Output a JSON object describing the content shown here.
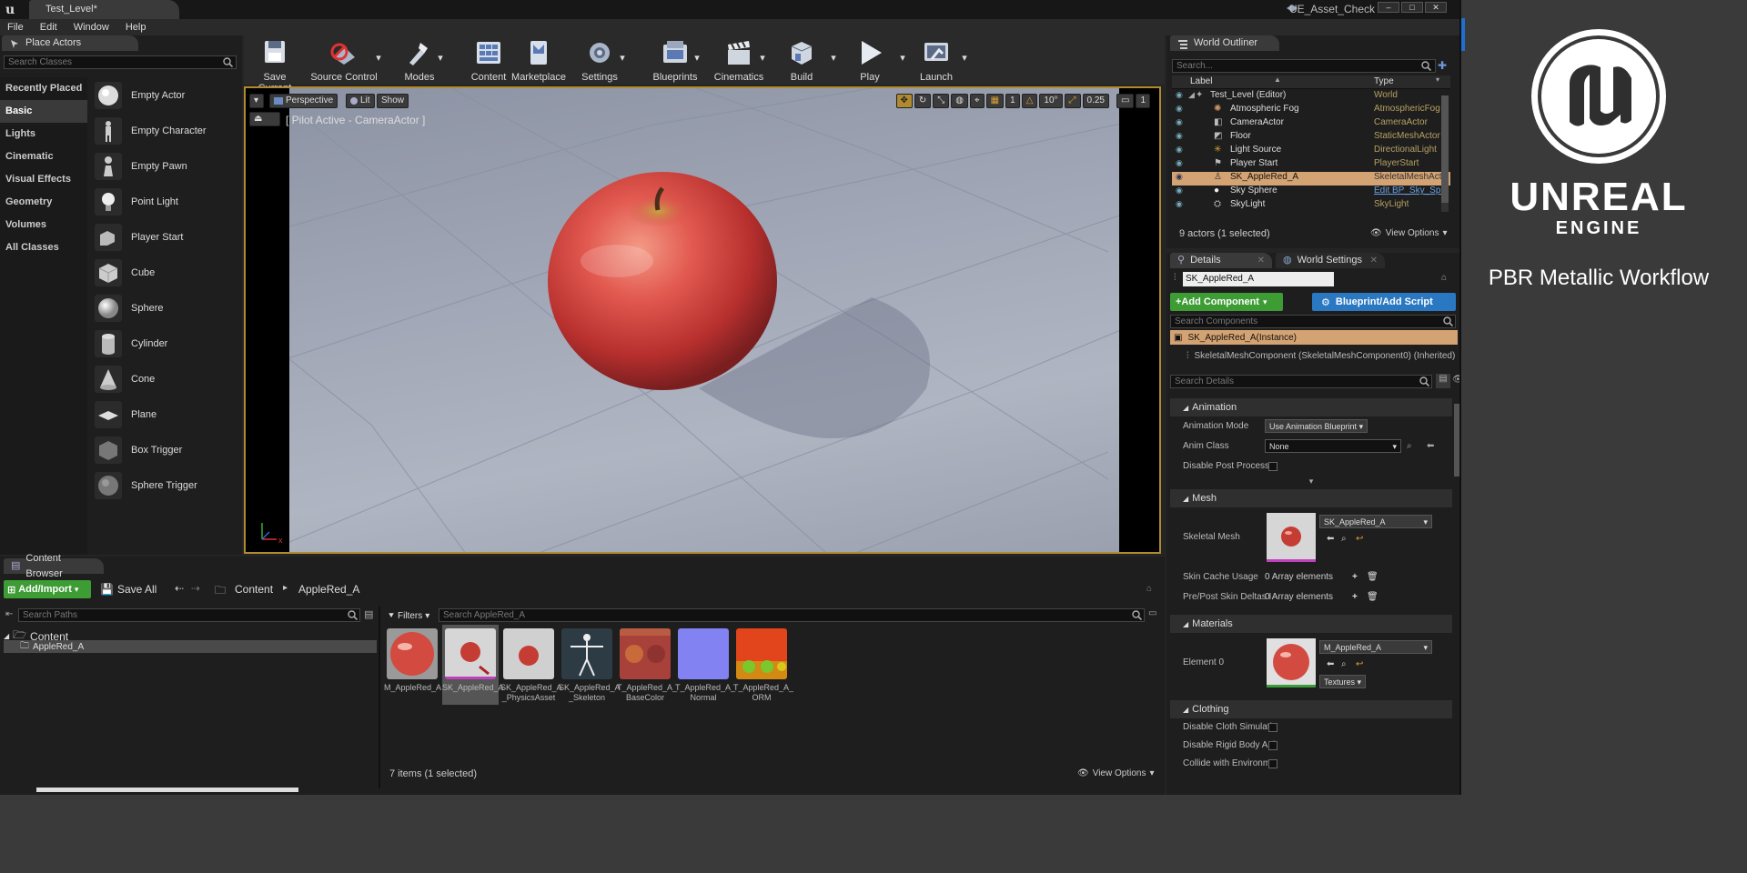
{
  "window": {
    "tab_title": "Test_Level*",
    "project_name": "UE_Asset_Check"
  },
  "menu": [
    "File",
    "Edit",
    "Window",
    "Help"
  ],
  "place_actors": {
    "tab": "Place Actors",
    "search_placeholder": "Search Classes",
    "categories": [
      "Recently Placed",
      "Basic",
      "Lights",
      "Cinematic",
      "Visual Effects",
      "Geometry",
      "Volumes",
      "All Classes"
    ],
    "selected_category": "Basic",
    "actors": [
      "Empty Actor",
      "Empty Character",
      "Empty Pawn",
      "Point Light",
      "Player Start",
      "Cube",
      "Sphere",
      "Cylinder",
      "Cone",
      "Plane",
      "Box Trigger",
      "Sphere Trigger"
    ]
  },
  "toolbar": {
    "save_current": "Save Current",
    "source_control": "Source Control",
    "modes": "Modes",
    "content": "Content",
    "marketplace": "Marketplace",
    "settings": "Settings",
    "blueprints": "Blueprints",
    "cinematics": "Cinematics",
    "build": "Build",
    "play": "Play",
    "launch": "Launch"
  },
  "viewport": {
    "perspective": "Perspective",
    "lit": "Lit",
    "show": "Show",
    "pilot_label": "[ Pilot Active - CameraActor ]",
    "grid_size": "1",
    "rotation_snap": "10°",
    "scale_snap": "0.25",
    "camera_speed": "1"
  },
  "outliner": {
    "tab": "World Outliner",
    "search_placeholder": "Search...",
    "col_label": "Label",
    "col_type": "Type",
    "rows": [
      {
        "label": "Test_Level (Editor)",
        "type": "World"
      },
      {
        "label": "Atmospheric Fog",
        "type": "AtmosphericFog"
      },
      {
        "label": "CameraActor",
        "type": "CameraActor"
      },
      {
        "label": "Floor",
        "type": "StaticMeshActor"
      },
      {
        "label": "Light Source",
        "type": "DirectionalLight"
      },
      {
        "label": "Player Start",
        "type": "PlayerStart"
      },
      {
        "label": "SK_AppleRed_A",
        "type": "SkeletalMeshActo"
      },
      {
        "label": "Sky Sphere",
        "type": "Edit BP_Sky_Sph"
      },
      {
        "label": "SkyLight",
        "type": "SkyLight"
      }
    ],
    "selected_index": 6,
    "status": "9 actors (1 selected)",
    "view_options": "View Options"
  },
  "details": {
    "tab_details": "Details",
    "tab_world_settings": "World Settings",
    "name_value": "SK_AppleRed_A",
    "add_component": "+Add Component",
    "blueprint_script": "Blueprint/Add Script",
    "search_components_placeholder": "Search Components",
    "instance_label": "SK_AppleRed_A(Instance)",
    "component_label": "SkeletalMeshComponent (SkeletalMeshComponent0) (Inherited)",
    "search_details_placeholder": "Search Details",
    "animation": {
      "header": "Animation",
      "anim_mode_label": "Animation Mode",
      "anim_mode_value": "Use Animation Blueprint",
      "anim_class_label": "Anim Class",
      "anim_class_value": "None",
      "disable_post_process": "Disable Post Process"
    },
    "mesh": {
      "header": "Mesh",
      "skeletal_mesh_label": "Skeletal Mesh",
      "skeletal_mesh_value": "SK_AppleRed_A",
      "skin_cache_label": "Skin Cache Usage",
      "skin_cache_value": "0 Array elements",
      "pre_post_label": "Pre/Post Skin Deltas I",
      "pre_post_value": "0 Array elements"
    },
    "materials": {
      "header": "Materials",
      "element0_label": "Element 0",
      "element0_value": "M_AppleRed_A",
      "textures_button": "Textures"
    },
    "clothing": {
      "header": "Clothing",
      "disable_cloth": "Disable Cloth Simulati",
      "disable_rigid": "Disable Rigid Body Ani",
      "collide_env": "Collide with Environme"
    }
  },
  "content_browser": {
    "tab": "Content Browser",
    "add_import": "Add/Import",
    "save_all": "Save All",
    "path_root": "Content",
    "path_current": "AppleRed_A",
    "search_paths_placeholder": "Search Paths",
    "tree_root": "Content",
    "tree_child": "AppleRed_A",
    "filters": "Filters",
    "search_assets_placeholder": "Search AppleRed_A",
    "assets": [
      {
        "name": "M_AppleRed_A"
      },
      {
        "name": "SK_AppleRed_A"
      },
      {
        "name": "SK_AppleRed_A _PhysicsAsset"
      },
      {
        "name": "SK_AppleRed_A _Skeleton"
      },
      {
        "name": "T_AppleRed_A_ BaseColor"
      },
      {
        "name": "T_AppleRed_A_ Normal"
      },
      {
        "name": "T_AppleRed_A_ ORM"
      }
    ],
    "selected_asset": 1,
    "status": "7 items (1 selected)",
    "view_options": "View Options"
  },
  "branding": {
    "logo_name": "unreal-engine-logo",
    "name_line1": "UNREAL",
    "name_line2": "ENGINE",
    "caption": "PBR Metallic Workflow"
  },
  "colors": {
    "accent": "#b08a2e",
    "selection": "#d4a373",
    "add_green": "#3e9c35",
    "blueprint_blue": "#2a78c2"
  }
}
